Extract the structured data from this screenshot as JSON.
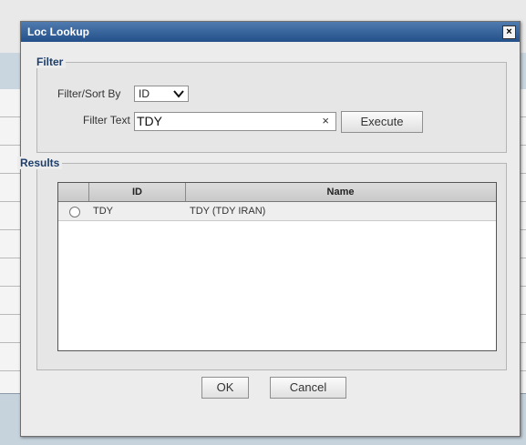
{
  "dialog": {
    "title": "Loc Lookup",
    "close_glyph": "×"
  },
  "filter": {
    "legend": "Filter",
    "sort_label": "Filter/Sort By",
    "sort_value": "ID",
    "text_label": "Filter Text",
    "text_value": "TDY",
    "clear_glyph": "×",
    "execute_label": "Execute"
  },
  "results": {
    "legend": "Results",
    "columns": [
      "ID",
      "Name"
    ],
    "rows": [
      {
        "id": "TDY",
        "name": "TDY (TDY IRAN)"
      }
    ]
  },
  "footer": {
    "ok_label": "OK",
    "cancel_label": "Cancel"
  }
}
